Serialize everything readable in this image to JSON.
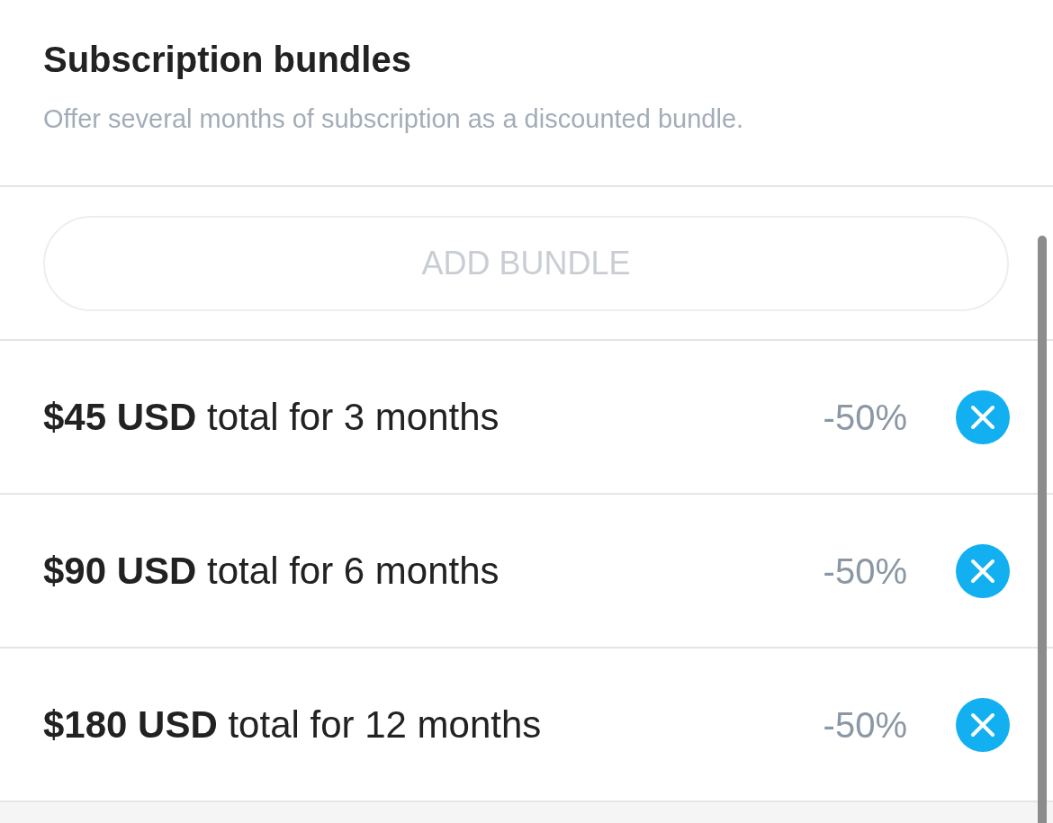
{
  "header": {
    "title": "Subscription bundles",
    "subtitle": "Offer several months of subscription as a discounted bundle."
  },
  "add_button": {
    "label": "ADD BUNDLE",
    "disabled": true
  },
  "bundles": [
    {
      "text": "**$45 USD** total for 3 months",
      "discount": "-50%"
    },
    {
      "text": "**$90 USD** total for 6 months",
      "discount": "-50%"
    },
    {
      "text": "**$180 USD** total for 12 months",
      "discount": "-50%"
    }
  ]
}
